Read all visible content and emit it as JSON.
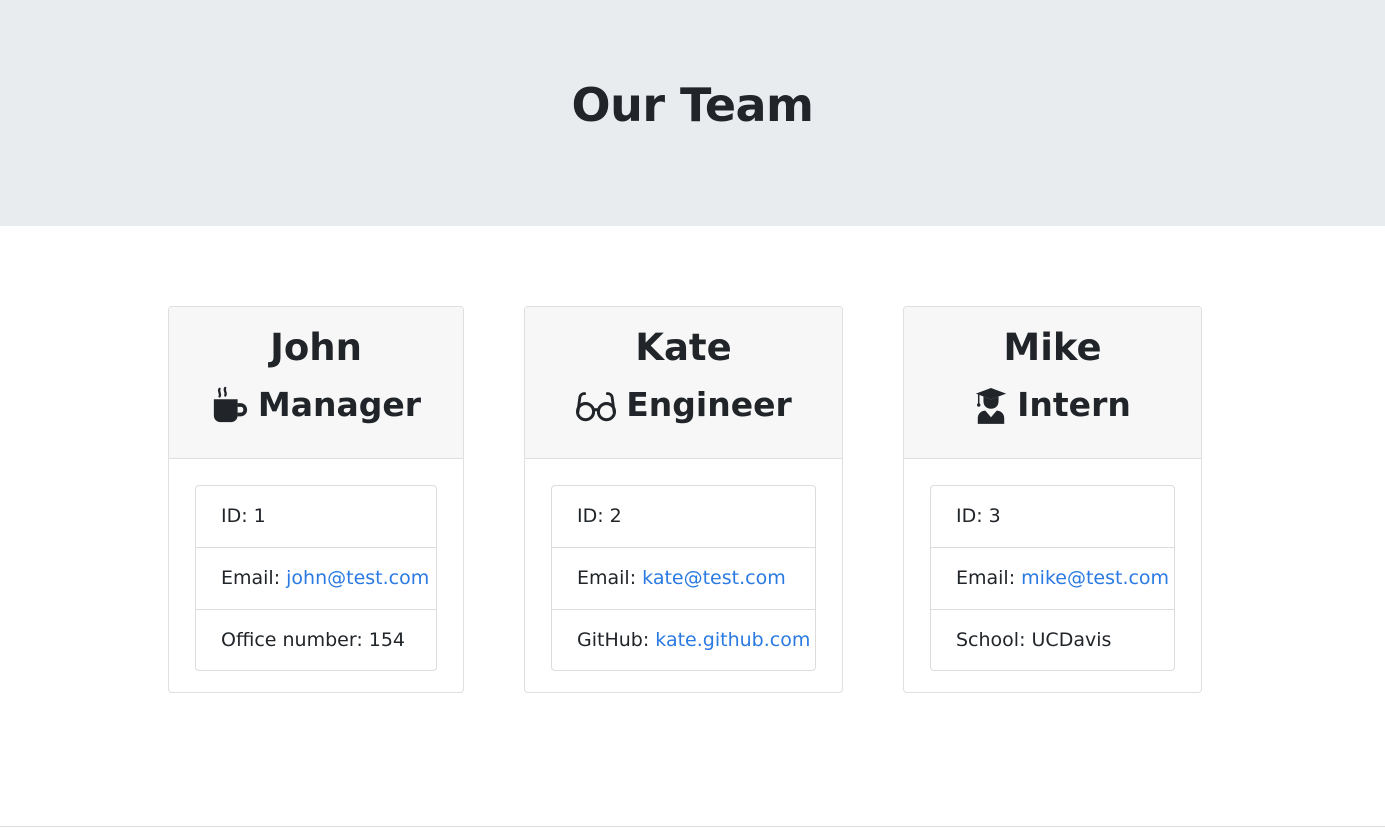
{
  "header": {
    "title": "Our Team"
  },
  "colors": {
    "jumbotron_bg": "#e9ecef",
    "card_header_bg": "#f7f7f7",
    "link": "#2a7ae2",
    "text": "#212529"
  },
  "team": [
    {
      "name": "John",
      "role": "Manager",
      "icon": "mug-hot-icon",
      "id_label": "ID: 1",
      "email_label": "Email: ",
      "email": "john@test.com",
      "extra_label": "Office number: 154",
      "extra_link": ""
    },
    {
      "name": "Kate",
      "role": "Engineer",
      "icon": "glasses-icon",
      "id_label": "ID: 2",
      "email_label": "Email: ",
      "email": "kate@test.com",
      "extra_label": "GitHub: ",
      "extra_link": "kate.github.com"
    },
    {
      "name": "Mike",
      "role": "Intern",
      "icon": "user-graduate-icon",
      "id_label": "ID: 3",
      "email_label": "Email: ",
      "email": "mike@test.com",
      "extra_label": "School: UCDavis",
      "extra_link": ""
    }
  ]
}
